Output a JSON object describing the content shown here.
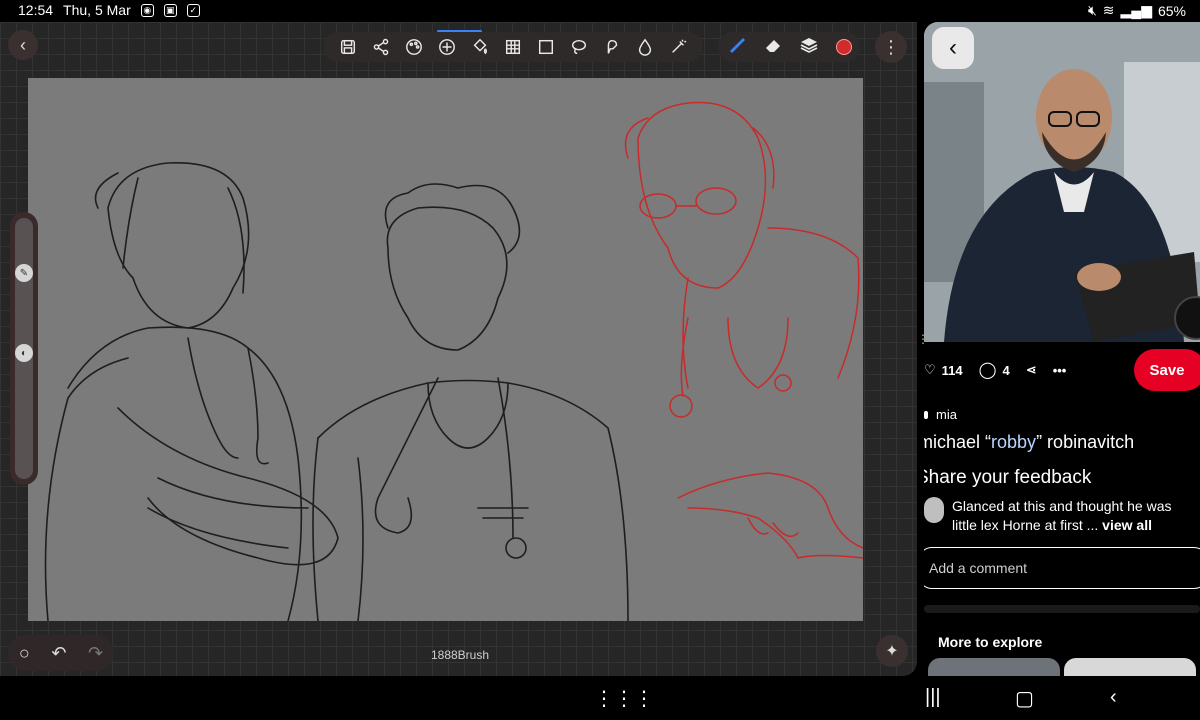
{
  "status_bar": {
    "time": "12:54",
    "date": "Thu, 5 Mar",
    "battery": "65%"
  },
  "app": {
    "brush_name": "1888Brush",
    "active_color": "#d12b2b",
    "accent_color": "#3b82f6",
    "toolbar_tools": [
      "save-icon",
      "share-icon",
      "palette-icon",
      "add-icon",
      "fill-icon",
      "grid-icon",
      "select-icon",
      "lasso-icon",
      "smudge-icon",
      "drop-icon",
      "magic-icon"
    ],
    "brush_tools": [
      "brush-icon",
      "eraser-icon",
      "layers-icon"
    ]
  },
  "pin": {
    "likes": "114",
    "comments": "4",
    "save_label": "Save",
    "author": "mia",
    "title_pre": "michael “",
    "title_highlight": "robby",
    "title_post": "” robinavitch",
    "feedback_heading": "Share your feedback",
    "comment_line1": "Glanced at this and thought he was",
    "comment_line2": "little lex Horne at first ... ",
    "view_all": "view all",
    "add_comment_placeholder": "Add a comment",
    "explore_title": "More to explore",
    "save_color": "#e60023"
  }
}
